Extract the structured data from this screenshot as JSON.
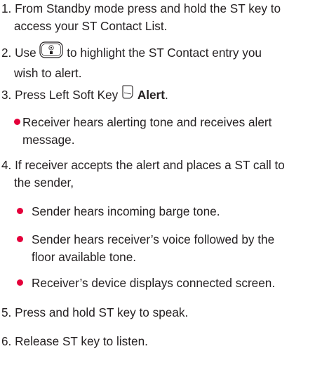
{
  "steps": [
    {
      "num": "1.",
      "line1": "From Standby mode press and hold the ST key to",
      "line2": "access your ST Contact List."
    },
    {
      "num": "2.",
      "pre": "Use",
      "post": "to highlight the ST Contact entry you",
      "line2": "wish to alert.",
      "icon": "navigation-key-icon"
    },
    {
      "num": "3.",
      "pre": "Press Left Soft Key",
      "bold": "Alert",
      "post": ".",
      "icon": "left-soft-key-icon"
    },
    {
      "num": "4.",
      "line1": "If receiver accepts the alert and places a ST call to",
      "line2": "the sender,"
    },
    {
      "num": "5.",
      "line1": "Press and hold ST key to speak."
    },
    {
      "num": "6.",
      "line1": "Release ST key to listen."
    }
  ],
  "step3_bullet": {
    "line1": "Receiver hears alerting tone and receives alert",
    "line2": "message."
  },
  "step4_bullets": [
    {
      "line1": "Sender hears incoming barge tone."
    },
    {
      "line1": "Sender hears receiver’s voice followed by the",
      "line2": "floor available tone."
    },
    {
      "line1": "Receiver’s device displays connected screen."
    }
  ],
  "colors": {
    "text": "#231f20",
    "bullet": "#e4003a"
  }
}
